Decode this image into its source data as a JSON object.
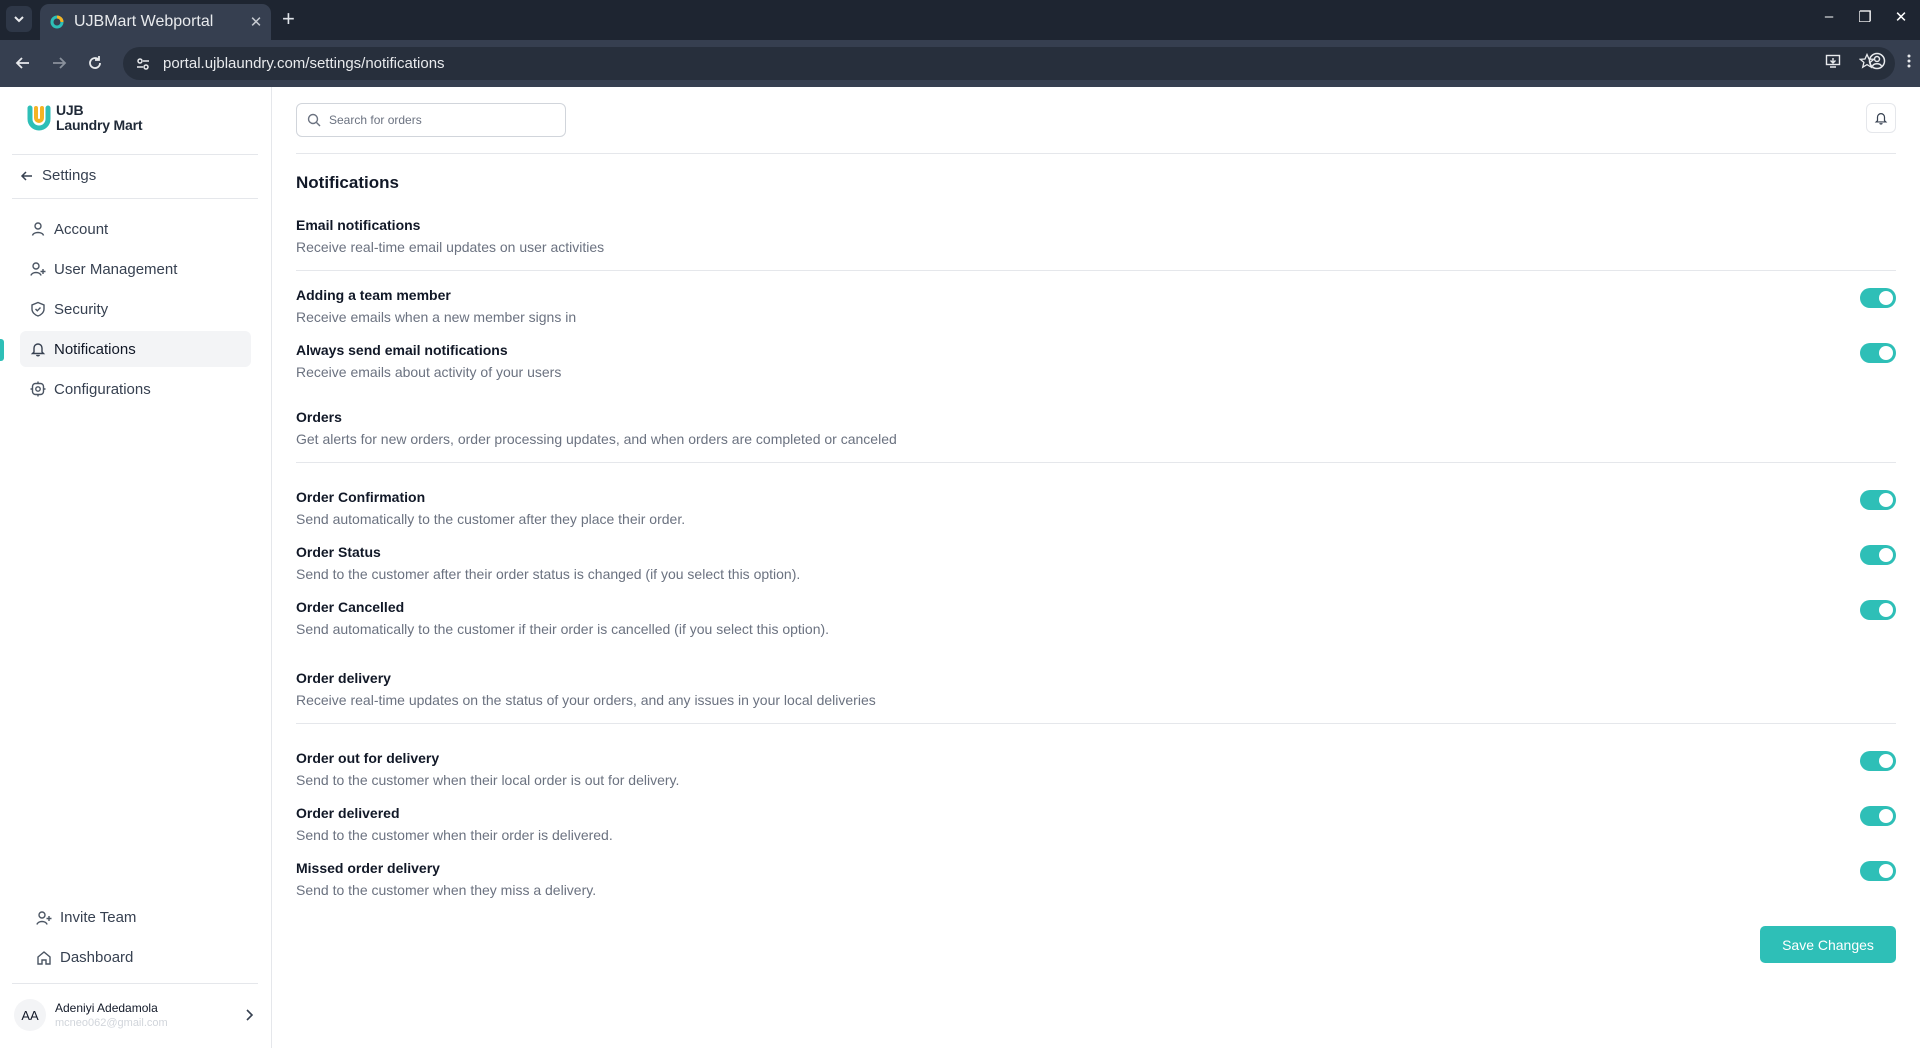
{
  "browser": {
    "tab_title": "UJBMart Webportal",
    "url": "portal.ujblaundry.com/settings/notifications",
    "new_tab_label": "+",
    "close_tab_label": "✕"
  },
  "brand": {
    "logo_line1": "UJB",
    "logo_line2": "Laundry Mart",
    "accent": "#2ebfb7"
  },
  "sidebar": {
    "back_label": "Settings",
    "items": [
      {
        "label": "Account",
        "icon": "user-icon"
      },
      {
        "label": "User Management",
        "icon": "user-plus-icon"
      },
      {
        "label": "Security",
        "icon": "shield-icon"
      },
      {
        "label": "Notifications",
        "icon": "bell-icon",
        "active": true
      },
      {
        "label": "Configurations",
        "icon": "gear-icon"
      }
    ],
    "bottom": [
      {
        "label": "Invite Team",
        "icon": "user-plus-icon"
      },
      {
        "label": "Dashboard",
        "icon": "home-icon"
      }
    ],
    "user": {
      "initials": "AA",
      "name": "Adeniyi Adedamola",
      "email": "mcneo062@gmail.com"
    }
  },
  "header": {
    "search_placeholder": "Search for orders"
  },
  "main": {
    "title": "Notifications",
    "sections": [
      {
        "title": "Email notifications",
        "description": "Receive real-time email updates on user activities",
        "items": [
          {
            "title": "Adding a team member",
            "description": "Receive emails when a new member signs in",
            "enabled": true
          },
          {
            "title": "Always send email notifications",
            "description": "Receive emails about activity of your users",
            "enabled": true
          }
        ]
      },
      {
        "title": "Orders",
        "description": "Get alerts for new orders, order processing updates, and when orders are completed or canceled",
        "items": [
          {
            "title": "Order Confirmation",
            "description": "Send automatically to the customer after they place their order.",
            "enabled": true
          },
          {
            "title": "Order Status",
            "description": "Send to the customer after their order status is changed (if you select this option).",
            "enabled": true
          },
          {
            "title": "Order Cancelled",
            "description": "Send automatically to the customer if their order is cancelled (if you select this option).",
            "enabled": true
          }
        ]
      },
      {
        "title": "Order delivery",
        "description": "Receive real-time updates on the status of your orders, and any issues in your local deliveries",
        "items": [
          {
            "title": "Order out for delivery",
            "description": "Send to the customer when their local order is out for delivery.",
            "enabled": true
          },
          {
            "title": "Order delivered",
            "description": "Send to the customer when their order is delivered.",
            "enabled": true
          },
          {
            "title": "Missed order delivery",
            "description": "Send to the customer when they miss a delivery.",
            "enabled": true
          }
        ]
      }
    ],
    "save_label": "Save Changes"
  }
}
